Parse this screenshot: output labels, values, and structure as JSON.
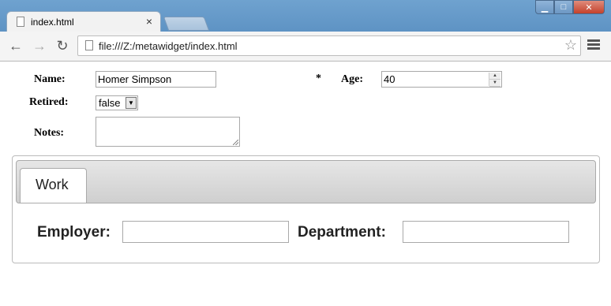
{
  "browser": {
    "tab_title": "index.html",
    "tab_close": "×",
    "url": "file:///Z:/metawidget/index.html",
    "back_icon": "←",
    "forward_icon": "→",
    "reload_icon": "↻",
    "star_icon": "☆",
    "min_icon": "▁",
    "max_icon": "□",
    "close_icon": "✕"
  },
  "form": {
    "name_label": "Name:",
    "name_value": "Homer Simpson",
    "required_marker": "*",
    "age_label": "Age:",
    "age_value": "40",
    "retired_label": "Retired:",
    "retired_value": "false",
    "notes_label": "Notes:"
  },
  "work": {
    "tab_label": "Work",
    "employer_label": "Employer:",
    "department_label": "Department:"
  }
}
